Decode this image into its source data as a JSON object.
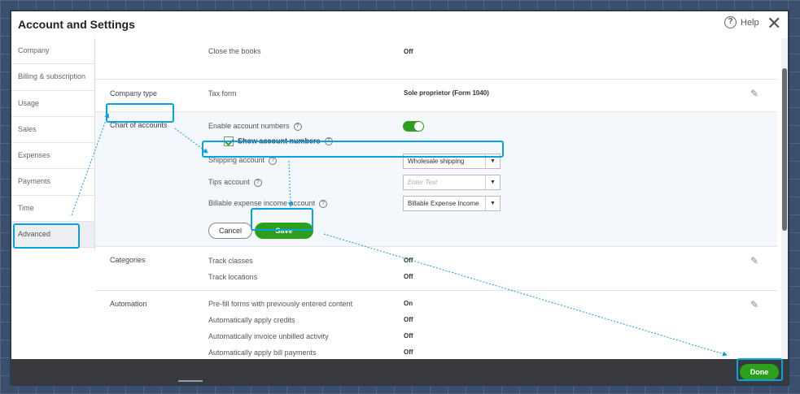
{
  "window": {
    "title": "Account and Settings",
    "help_label": "Help",
    "help_glyph": "?",
    "close_glyph": "✕"
  },
  "sidebar": {
    "items": [
      {
        "label": "Company"
      },
      {
        "label": "Billing & subscription"
      },
      {
        "label": "Usage"
      },
      {
        "label": "Sales"
      },
      {
        "label": "Expenses"
      },
      {
        "label": "Payments"
      },
      {
        "label": "Time"
      },
      {
        "label": "Advanced",
        "active": true
      }
    ]
  },
  "rows": {
    "close_books": {
      "label": "Close the books",
      "value": "Off"
    },
    "company_type": {
      "section": "Company type",
      "label": "Tax form",
      "value": "Sole proprietor (Form 1040)"
    },
    "chart_of_accounts": {
      "section": "Chart of accounts",
      "enable_label": "Enable account numbers",
      "show_numbers_label": "Show account numbers",
      "shipping_label": "Shipping account",
      "shipping_value": "Wholesale shipping",
      "tips_label": "Tips account",
      "tips_placeholder": "Enter Text",
      "billable_label": "Billable expense income account",
      "billable_value": "Billable Expense Income",
      "cancel": "Cancel",
      "save": "Save"
    },
    "categories": {
      "section": "Categories",
      "items": [
        {
          "label": "Track classes",
          "value": "Off"
        },
        {
          "label": "Track locations",
          "value": "Off"
        }
      ]
    },
    "automation": {
      "section": "Automation",
      "items": [
        {
          "label": "Pre-fill forms with previously entered content",
          "value": "On"
        },
        {
          "label": "Automatically apply credits",
          "value": "Off"
        },
        {
          "label": "Automatically invoice unbilled activity",
          "value": "Off"
        },
        {
          "label": "Automatically apply bill payments",
          "value": "Off"
        }
      ]
    }
  },
  "icons": {
    "question": "?",
    "caret": "▼",
    "pencil": "✎"
  },
  "footer": {
    "done": "Done"
  },
  "colors": {
    "accent_green": "#2ca01c",
    "highlight_blue": "#0aa1e0",
    "footer_bg": "#393a3d"
  }
}
